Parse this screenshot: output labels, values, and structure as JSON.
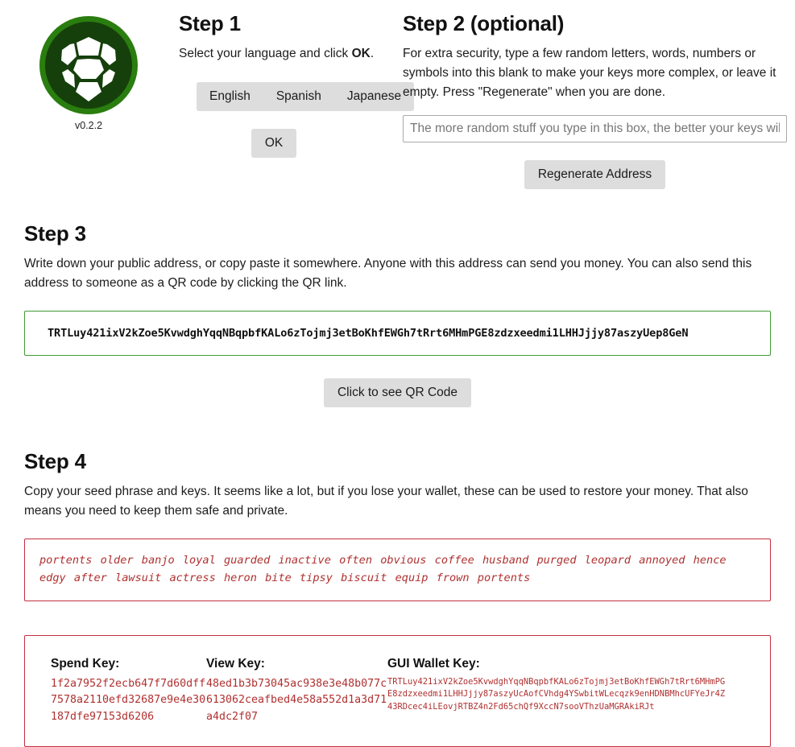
{
  "app": {
    "logo_icon": "turtlecoin-shield-icon",
    "version": "v0.2.2",
    "logo_ring_color": "#2a7d0f",
    "logo_body_color": "#15400b"
  },
  "step1": {
    "title": "Step 1",
    "description_before": "Select your language and click ",
    "description_bold": "OK",
    "description_after": ".",
    "languages": [
      {
        "label": "English"
      },
      {
        "label": "Spanish"
      },
      {
        "label": "Japanese"
      }
    ],
    "ok_label": "OK"
  },
  "step2": {
    "title": "Step 2 (optional)",
    "description": "For extra security, type a few random letters, words, numbers or symbols into this blank to make your keys more complex, or leave it empty. Press \"Regenerate\" when you are done.",
    "input_placeholder": "The more random stuff you type in this box, the better your keys will be.",
    "input_value": "",
    "regenerate_label": "Regenerate Address"
  },
  "step3": {
    "title": "Step 3",
    "description": "Write down your public address, or copy paste it somewhere. Anyone with this address can send you money. You can also send this address to someone as a QR code by clicking the QR link.",
    "address": "TRTLuy421ixV2kZoe5KvwdghYqqNBqpbfKALo6zTojmj3etBoKhfEWGh7tRrt6MHmPGE8zdzxeedmi1LHHJjjy87aszyUep8GeN",
    "address_border_color": "#3f9c35",
    "qr_button_label": "Click to see QR Code"
  },
  "step4": {
    "title": "Step 4",
    "description": "Copy your seed phrase and keys. It seems like a lot, but if you lose your wallet, these can be used to restore your money. That also means you need to keep them safe and private.",
    "seed_phrase": "portents older banjo loyal guarded inactive often obvious coffee husband purged leopard annoyed hence edgy after lawsuit actress heron bite tipsy biscuit equip frown portents",
    "seed_border_color": "#c4303f",
    "seed_text_color": "#b03030",
    "keys": {
      "spend_label": "Spend Key:",
      "spend_value": "1f2a7952f2ecb647f7d60dff7578a2110efd32687e9e4e30187dfe97153d6206",
      "view_label": "View Key:",
      "view_value": "48ed1b3b73045ac938e3e48b077c613062ceafbed4e58a552d1a3d71a4dc2f07",
      "gui_label": "GUI Wallet Key:",
      "gui_value": "TRTLuy421ixV2kZoe5KvwdghYqqNBqpbfKALo6zTojmj3etBoKhfEWGh7tRrt6MHmPGE8zdzxeedmi1LHHJjjy87aszyUcAofCVhdg4YSwbitWLecqzk9enHDNBMhcUFYeJr4Z43RDcec4iLEovjRTBZ4n2Fd65chQf9XccN7sooVThzUaMGRAkiRJt"
    }
  }
}
